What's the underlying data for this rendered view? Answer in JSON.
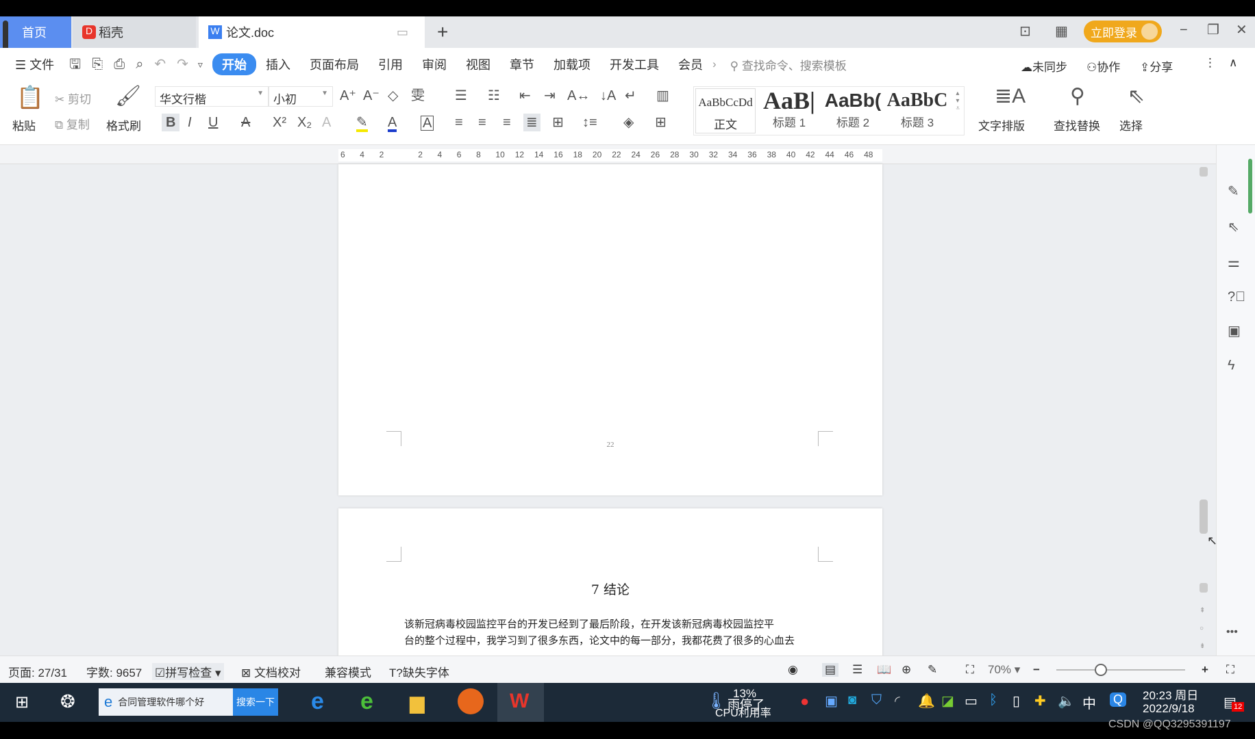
{
  "tabs": [
    {
      "label": "首页"
    },
    {
      "label": "稻壳"
    },
    {
      "label": "论文.doc"
    }
  ],
  "titlebar": {
    "login": "立即登录"
  },
  "menu": {
    "file": "文件",
    "items": [
      "开始",
      "插入",
      "页面布局",
      "引用",
      "审阅",
      "视图",
      "章节",
      "加载项",
      "开发工具",
      "会员"
    ],
    "search_placeholder": "查找命令、搜索模板",
    "sync": "未同步",
    "collab": "协作",
    "share": "分享"
  },
  "ribbon": {
    "paste": "粘贴",
    "cut": "剪切",
    "copy": "复制",
    "format_painter": "格式刷",
    "font": "华文行楷",
    "size": "小初",
    "styles": [
      {
        "sample": "AaBbCcDd",
        "label": "正文"
      },
      {
        "sample": "AaB|",
        "label": "标题 1"
      },
      {
        "sample": "AaBb(",
        "label": "标题 2"
      },
      {
        "sample": "AaBbC",
        "label": "标题 3"
      }
    ],
    "text_layout": "文字排版",
    "find_replace": "查找替换",
    "select": "选择"
  },
  "ruler": {
    "ticks": [
      "6",
      "4",
      "2",
      "",
      "2",
      "4",
      "6",
      "8",
      "10",
      "12",
      "14",
      "16",
      "18",
      "20",
      "22",
      "24",
      "26",
      "28",
      "30",
      "32",
      "34",
      "36",
      "38",
      "40",
      "42",
      "44",
      "46",
      "48"
    ]
  },
  "document": {
    "page_number": "22",
    "heading": "7  结论",
    "para_line1": "该新冠病毒校园监控平台的开发已经到了最后阶段，在开发该新冠病毒校园监控平",
    "para_line2": "台的整个过程中，我学习到了很多东西，论文中的每一部分，我都花费了很多的心血去"
  },
  "status": {
    "page": "页面: 27/31",
    "words": "字数: 9657",
    "spell": "拼写检查",
    "proof": "文档校对",
    "compat": "兼容模式",
    "missing_font": "缺失字体",
    "zoom": "70%",
    "zoom_level": 70
  },
  "taskbar": {
    "search_text": "合同管理软件哪个好",
    "search_btn": "搜索一下",
    "cpu": "13%",
    "cpu_label": "CPU利用率",
    "weather": "雨停了",
    "ime": "中",
    "time": "20:23 周日",
    "date": "2022/9/18",
    "notif": "12"
  },
  "watermark": "CSDN @QQ3295391197",
  "colors": {
    "accent": "#3b8cf0",
    "login": "#f0a81c",
    "wps_red": "#e8352b"
  }
}
